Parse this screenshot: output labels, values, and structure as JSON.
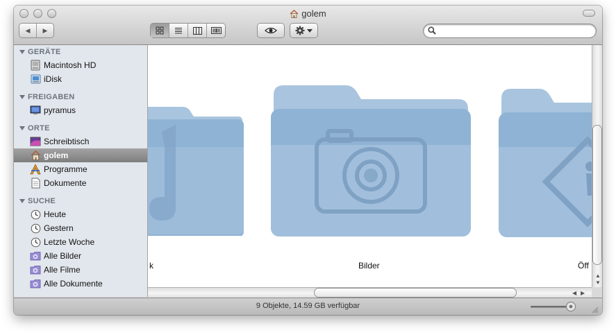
{
  "window": {
    "title": "golem"
  },
  "toolbar": {
    "back_label": "◀",
    "forward_label": "▶",
    "search_value": "",
    "search_placeholder": ""
  },
  "sidebar": {
    "sections": [
      {
        "label": "GERÄTE",
        "items": [
          {
            "label": "Macintosh HD",
            "icon": "hard-drive-icon"
          },
          {
            "label": "iDisk",
            "icon": "idisk-icon"
          }
        ]
      },
      {
        "label": "FREIGABEN",
        "items": [
          {
            "label": "pyramus",
            "icon": "computer-monitor-icon"
          }
        ]
      },
      {
        "label": "ORTE",
        "items": [
          {
            "label": "Schreibtisch",
            "icon": "desktop-icon"
          },
          {
            "label": "golem",
            "icon": "home-icon",
            "selected": true
          },
          {
            "label": "Programme",
            "icon": "applications-icon"
          },
          {
            "label": "Dokumente",
            "icon": "document-icon"
          }
        ]
      },
      {
        "label": "SUCHE",
        "items": [
          {
            "label": "Heute",
            "icon": "clock-icon"
          },
          {
            "label": "Gestern",
            "icon": "clock-icon"
          },
          {
            "label": "Letzte Woche",
            "icon": "clock-icon"
          },
          {
            "label": "Alle Bilder",
            "icon": "smart-folder-icon"
          },
          {
            "label": "Alle Filme",
            "icon": "smart-folder-icon"
          },
          {
            "label": "Alle Dokumente",
            "icon": "smart-folder-icon"
          }
        ]
      }
    ]
  },
  "content": {
    "items": [
      {
        "label": "k",
        "icon": "music-folder-icon"
      },
      {
        "label": "Bilder",
        "icon": "pictures-folder-icon"
      },
      {
        "label": "Öff",
        "icon": "public-folder-icon"
      }
    ]
  },
  "status": {
    "text": "9 Objekte, 14.59 GB verfügbar"
  },
  "colors": {
    "folder": "#8fb3d4",
    "selection": "#8e8e8e",
    "sidebar": "#e2e7ed"
  }
}
